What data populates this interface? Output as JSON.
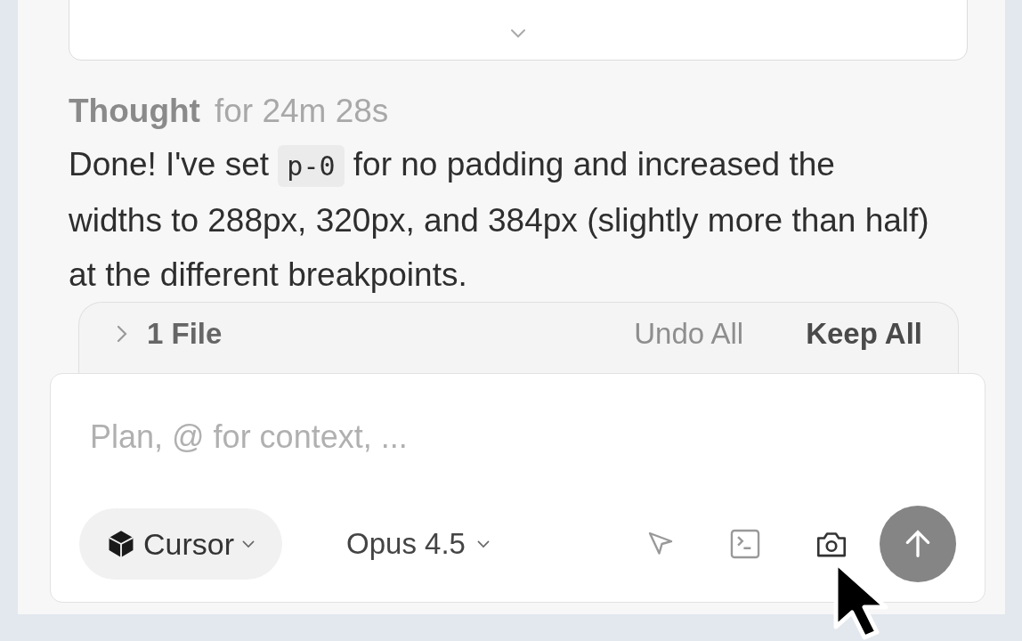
{
  "thought": {
    "label": "Thought",
    "duration": "for 24m 28s"
  },
  "message": {
    "before": "Done! I've set ",
    "code": "p-0",
    "after": " for no padding and increased the widths to 288px, 320px, and 384px (slightly more than half) at the different breakpoints."
  },
  "files_bar": {
    "expanded": false,
    "count": "1 File",
    "undo": "Undo All",
    "keep": "Keep All"
  },
  "composer": {
    "placeholder": "Plan, @ for context, ...",
    "mode": "Cursor",
    "model": "Opus 4.5"
  }
}
